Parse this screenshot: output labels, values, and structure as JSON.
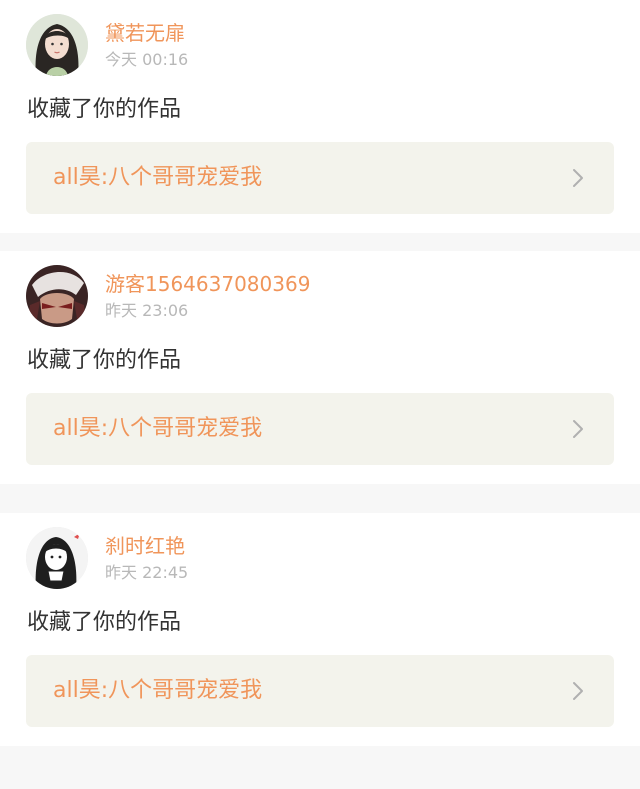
{
  "notifications": [
    {
      "user": "黛若无扉",
      "time": "今天 00:16",
      "action": "收藏了你的作品",
      "work_title": "all昊:八个哥哥宠爱我"
    },
    {
      "user": "游客1564637080369",
      "time": "昨天 23:06",
      "action": "收藏了你的作品",
      "work_title": "all昊:八个哥哥宠爱我"
    },
    {
      "user": "刹时红艳",
      "time": "昨天 22:45",
      "action": "收藏了你的作品",
      "work_title": "all昊:八个哥哥宠爱我"
    }
  ],
  "colors": {
    "accent": "#f0955a",
    "timestamp": "#b8b8b8",
    "card_link_bg": "#f3f3ec",
    "separator": "#f7f7f7"
  },
  "icons": {
    "chevron": "chevron-right-icon"
  }
}
